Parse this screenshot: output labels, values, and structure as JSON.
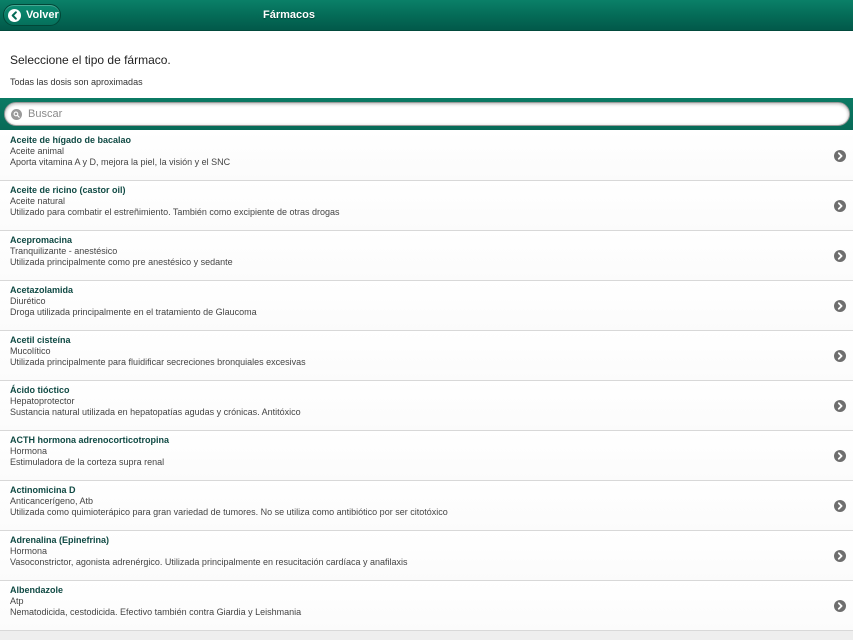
{
  "header": {
    "back_label": "Volver",
    "title": "Fármacos"
  },
  "intro": {
    "title": "Seleccione el tipo de fármaco.",
    "note": "Todas las dosis son aproximadas"
  },
  "search": {
    "placeholder": "Buscar"
  },
  "items": [
    {
      "name": "Aceite de hígado de bacalao",
      "type": "Aceite animal",
      "desc": "Aporta vitamina A y D, mejora la piel, la visión y el SNC"
    },
    {
      "name": "Aceite de ricino (castor oil)",
      "type": "Aceite natural",
      "desc": "Utilizado para combatir el estreñimiento. También como excipiente de otras drogas"
    },
    {
      "name": "Acepromacina",
      "type": "Tranquilizante - anestésico",
      "desc": "Utilizada principalmente como pre anestésico y sedante"
    },
    {
      "name": "Acetazolamida",
      "type": "Diurético",
      "desc": "Droga utilizada principalmente en el tratamiento de Glaucoma"
    },
    {
      "name": "Acetil cisteína",
      "type": "Mucolítico",
      "desc": "Utilizada principalmente para fluidificar secreciones bronquiales excesivas"
    },
    {
      "name": "Ácido tióctico",
      "type": "Hepatoprotector",
      "desc": "Sustancia natural utilizada en hepatopatías agudas y crónicas. Antitóxico"
    },
    {
      "name": "ACTH hormona adrenocorticotropina",
      "type": "Hormona",
      "desc": "Estimuladora de la corteza supra renal"
    },
    {
      "name": "Actinomicina D",
      "type": "Anticancerígeno, Atb",
      "desc": "Utilizada como quimioterápico para gran variedad de tumores. No se utiliza como antibiótico por ser citotóxico"
    },
    {
      "name": "Adrenalina (Epinefrina)",
      "type": "Hormona",
      "desc": "Vasoconstrictor, agonista adrenérgico. Utilizada principalmente en resucitación cardíaca y anafilaxis"
    },
    {
      "name": "Albendazole",
      "type": "Atp",
      "desc": "Nematodicida, cestodicida. Efectivo también contra Giardia y Leishmania"
    }
  ],
  "icons": {
    "back": "arrow-left-circle-icon",
    "search": "search-icon",
    "item_chevron": "chevron-right-circle-icon"
  },
  "colors": {
    "header": "#046a56",
    "item_title": "#104a44",
    "chevron": "#6e6e6e"
  }
}
